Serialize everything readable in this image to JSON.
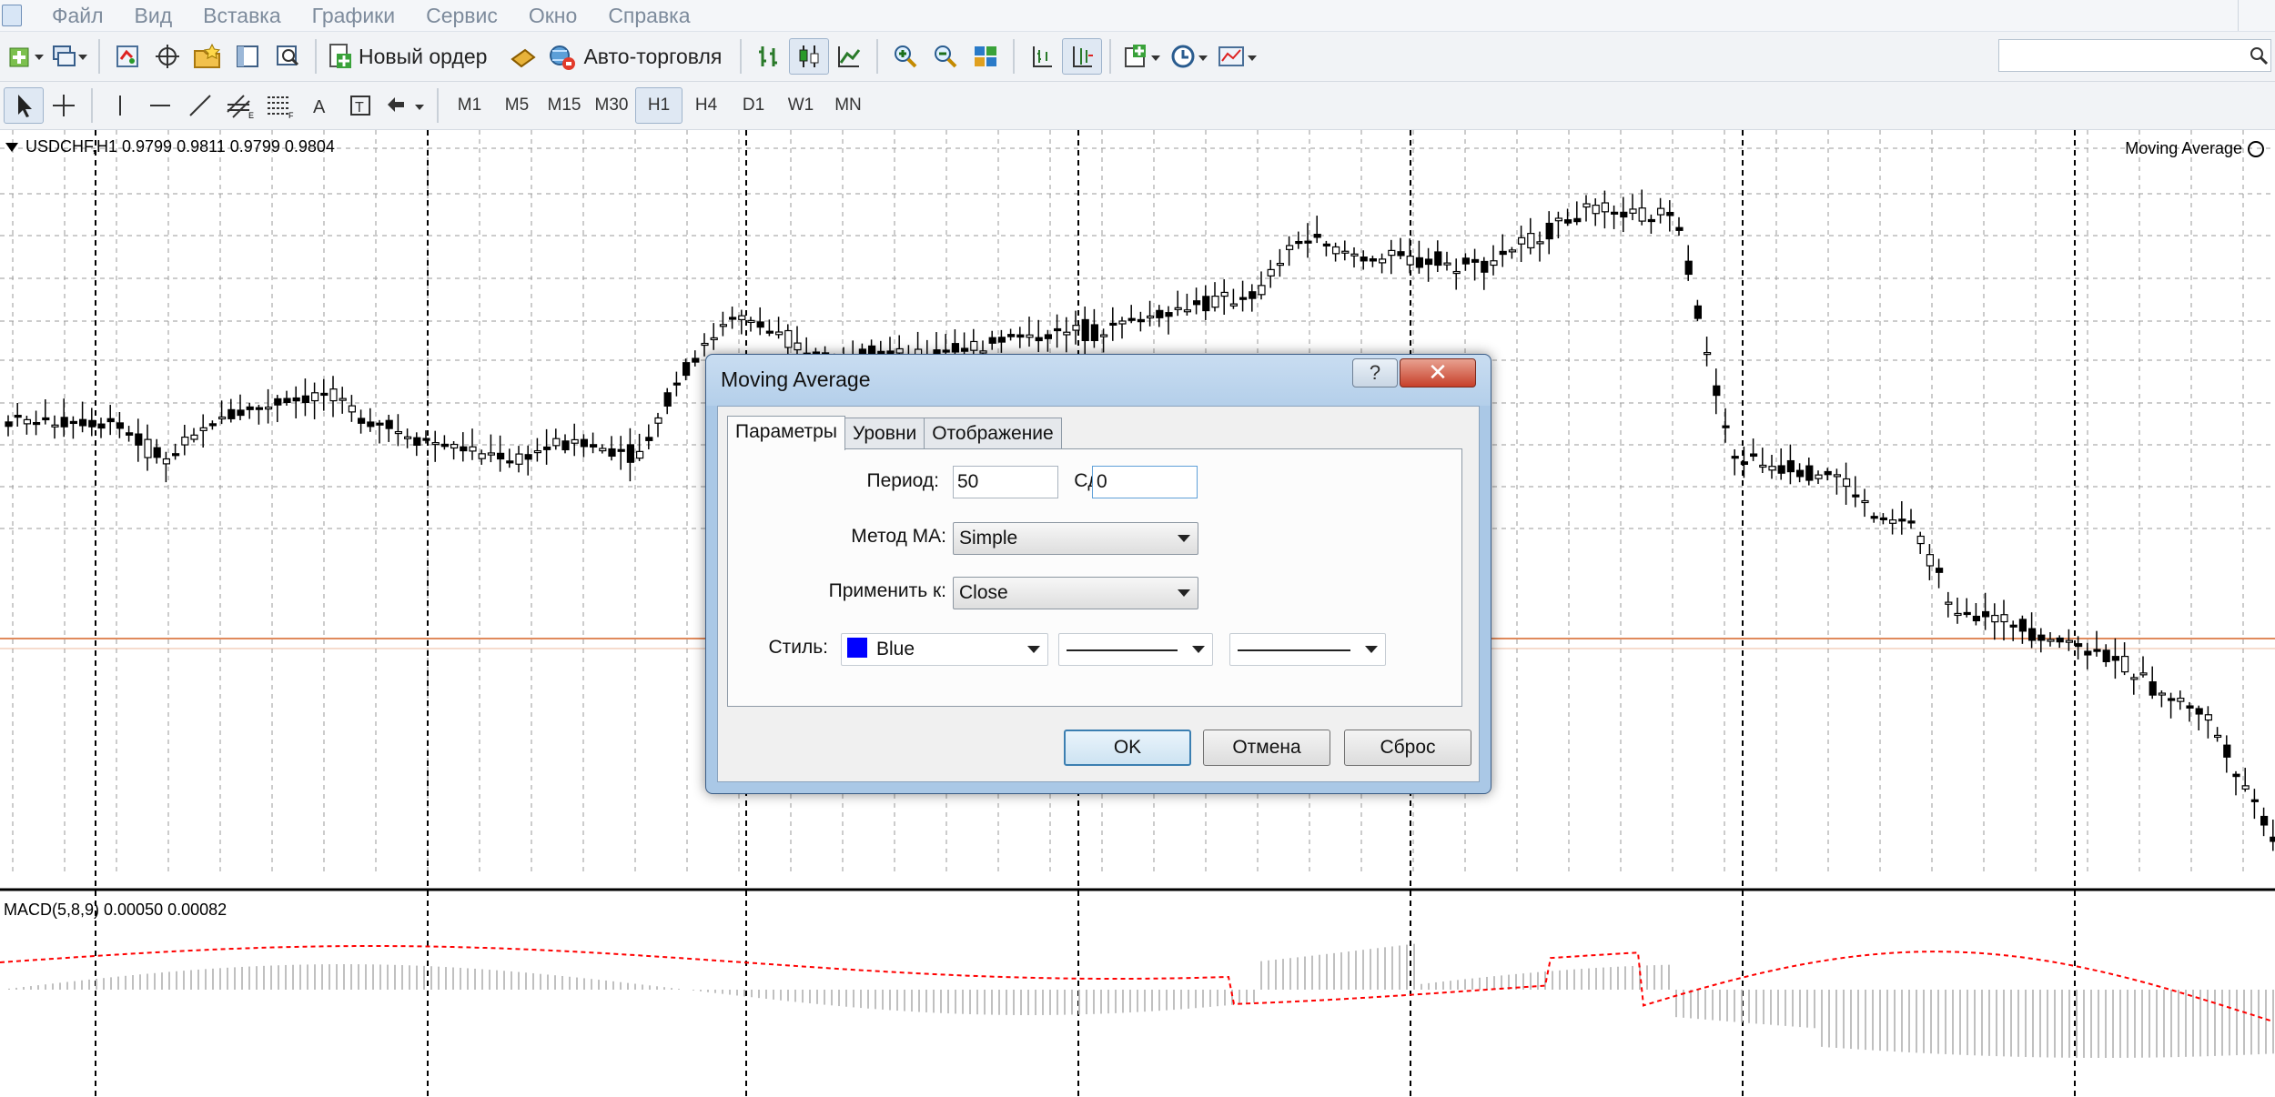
{
  "menu": {
    "items": [
      "Файл",
      "Вид",
      "Вставка",
      "Графики",
      "Сервис",
      "Окно",
      "Справка"
    ]
  },
  "toolbar": {
    "new_order_label": "Новый ордер",
    "auto_trading_label": "Авто-торговля",
    "search_value": ""
  },
  "timeframes": [
    "M1",
    "M5",
    "M15",
    "M30",
    "H1",
    "H4",
    "D1",
    "W1",
    "MN"
  ],
  "timeframe_selected": "H1",
  "chart": {
    "symbol_header": "USDCHF,H1  0.9799 0.9811 0.9799 0.9804",
    "indicator_label": "Moving Average",
    "macd_header": "MACD(5,8,9) 0.00050 0.00082",
    "colors": {
      "candle": "#000000",
      "grid": "#9a9a9a",
      "price_line": "#e08a5c",
      "macd_signal": "#ff0000",
      "macd_hist": "#c0c0c0"
    }
  },
  "dialog": {
    "title": "Moving Average",
    "help_label": "?",
    "close_label": "✕",
    "tabs": [
      "Параметры",
      "Уровни",
      "Отображение"
    ],
    "active_tab": "Параметры",
    "period_label": "Период:",
    "period_value": "50",
    "shift_label": "Сдвиг:",
    "shift_value": "0",
    "ma_method_label": "Метод МА:",
    "ma_method_value": "Simple",
    "apply_to_label": "Применить к:",
    "apply_to_value": "Close",
    "style_label": "Стиль:",
    "style_color_name": "Blue",
    "style_color": "#0000ff",
    "ok_label": "OK",
    "cancel_label": "Отмена",
    "reset_label": "Сброс"
  }
}
